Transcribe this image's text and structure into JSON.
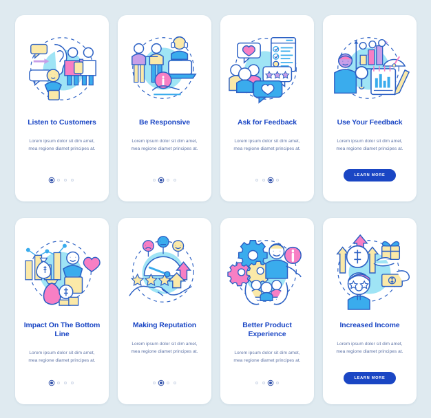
{
  "theme": {
    "page_background": "#dfeaf0",
    "card_background": "#ffffff",
    "title_color": "#1a46c4",
    "body_color": "#5f74a6",
    "accent_blue": "#1a46c4",
    "art_cyan": "#8fe0f2",
    "art_blue": "#3aaced",
    "art_pink": "#f77fc4",
    "art_yellow": "#fbe9a8",
    "art_purple": "#c89fe8",
    "art_outline": "#2b60c4",
    "dot_inactive": "#cdd6e6",
    "dot_active": "#2f4fa8"
  },
  "screens": [
    {
      "id": "listen-to-customers",
      "title": "Listen to Customers",
      "body": "Lorem ipsum dolor sit dim amet, mea regione diamet principes at.",
      "illustration": "ear-listening-speech-bubbles-people-icon",
      "pagination": {
        "total": 4,
        "active_index": 0
      },
      "cta": null
    },
    {
      "id": "be-responsive",
      "title": "Be Responsive",
      "body": "Lorem ipsum dolor sit dim amet, mea regione diamet principes at.",
      "illustration": "support-agent-laptop-info-hand-icon",
      "pagination": {
        "total": 4,
        "active_index": 1
      },
      "cta": null
    },
    {
      "id": "ask-for-feedback",
      "title": "Ask for Feedback",
      "body": "Lorem ipsum dolor sit dim amet, mea regione diamet principes at.",
      "illustration": "survey-checklist-heart-stars-review-icon",
      "pagination": {
        "total": 4,
        "active_index": 2
      },
      "cta": null
    },
    {
      "id": "use-your-feedback",
      "title": "Use Your Feedback",
      "body": "Lorem ipsum dolor sit dim amet, mea regione diamet principes at.",
      "illustration": "analytics-chart-magnifier-clipboard-pencil-icon",
      "pagination": null,
      "cta": "LEARN MORE"
    },
    {
      "id": "impact-on-the-bottom-line",
      "title": "Impact On The Bottom Line",
      "body": "Lorem ipsum dolor sit dim amet, mea regione diamet principes at.",
      "illustration": "money-bag-chart-shopping-bag-heart-icon",
      "pagination": {
        "total": 4,
        "active_index": 0
      },
      "cta": null
    },
    {
      "id": "making-reputation",
      "title": "Making Reputation",
      "body": "Lorem ipsum dolor sit dim amet, mea regione diamet principes at.",
      "illustration": "rating-gauge-stars-handshake-arrow-icon",
      "pagination": {
        "total": 4,
        "active_index": 1
      },
      "cta": null
    },
    {
      "id": "better-product-experience",
      "title": "Better Product Experience",
      "body": "Lorem ipsum dolor sit dim amet, mea regione diamet principes at.",
      "illustration": "gears-person-info-hands-users-icon",
      "pagination": {
        "total": 4,
        "active_index": 2
      },
      "cta": null
    },
    {
      "id": "increased-income",
      "title": "Increased Income",
      "body": "Lorem ipsum dolor sit dim amet, mea regione diamet principes at.",
      "illustration": "growth-arrows-dollar-gift-money-star-eyes-icon",
      "pagination": null,
      "cta": "LEARN MORE"
    }
  ]
}
